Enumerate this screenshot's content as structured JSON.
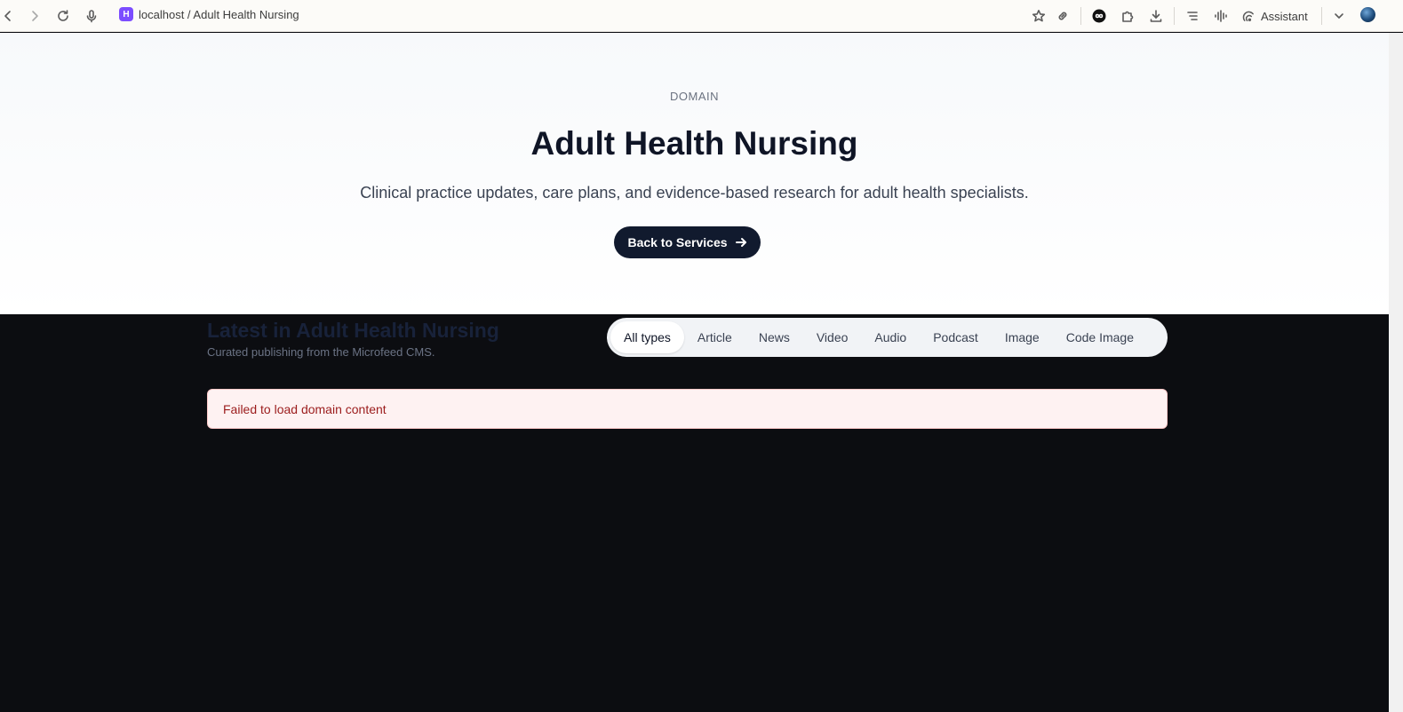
{
  "browser": {
    "favicon_letter": "H",
    "url": "localhost / Adult Health Nursing",
    "assistant_label": "Assistant",
    "favicon_color": "#7c4dff"
  },
  "hero": {
    "kicker": "DOMAIN",
    "title": "Adult Health Nursing",
    "subtitle": "Clinical practice updates, care plans, and evidence-based research for adult health specialists.",
    "back_button": "Back to Services"
  },
  "latest": {
    "title": "Latest in Adult Health Nursing",
    "subtitle": "Curated publishing from the Microfeed CMS."
  },
  "filters": {
    "items": [
      "All types",
      "Article",
      "News",
      "Video",
      "Audio",
      "Podcast",
      "Image",
      "Code Image"
    ],
    "active": "All types"
  },
  "error": {
    "message": "Failed to load domain content"
  },
  "colors": {
    "accent_dark": "#111a2e",
    "page_dark": "#0c0d11",
    "error_bg": "#fef2f2",
    "error_text": "#9b1c1c"
  }
}
